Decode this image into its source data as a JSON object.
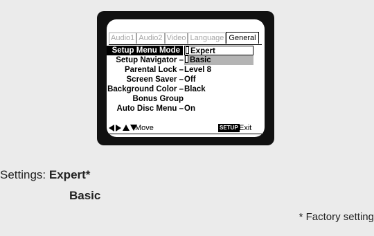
{
  "tabs": [
    {
      "label": "Audio1",
      "active": false
    },
    {
      "label": "Audio2",
      "active": false
    },
    {
      "label": "Video",
      "active": false
    },
    {
      "label": "Language",
      "active": false
    },
    {
      "label": "General",
      "active": true
    }
  ],
  "menu": {
    "rows": [
      {
        "label": "Setup Menu Mode",
        "value": ""
      },
      {
        "label": "Setup Navigator –",
        "value": ""
      },
      {
        "label": "Parental Lock –",
        "value": "Level 8"
      },
      {
        "label": "Screen Saver –",
        "value": "Off"
      },
      {
        "label": "Background Color –",
        "value": "Black"
      },
      {
        "label": "Bonus Group",
        "value": ""
      },
      {
        "label": "Auto Disc Menu –",
        "value": "On"
      }
    ],
    "options": {
      "expert": "Expert",
      "basic": "Basic"
    }
  },
  "footer": {
    "move": "Move",
    "setup_badge": "SETUP",
    "exit": "Exit"
  },
  "caption": {
    "settings_label": "Settings:",
    "option1": "Expert*",
    "option2": "Basic",
    "factory_note": "* Factory setting"
  },
  "colors": {
    "page_bg": "#ebebeb",
    "tv_frame": "#111111",
    "highlight": "#000000",
    "basic_highlight": "#b4b4b4"
  },
  "icons": [
    "left-arrow-icon",
    "right-arrow-icon",
    "up-arrow-icon",
    "down-arrow-icon"
  ]
}
